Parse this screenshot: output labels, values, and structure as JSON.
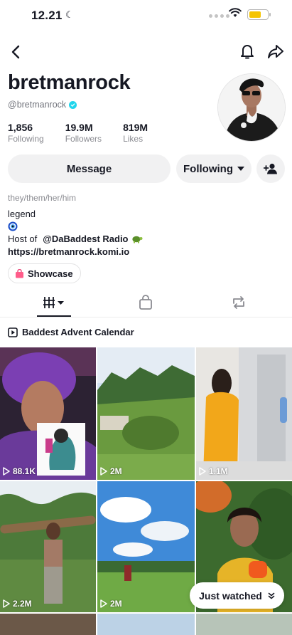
{
  "status_bar": {
    "time": "12.21"
  },
  "profile": {
    "name": "bretmanrock",
    "handle": "@bretmanrock",
    "stats": [
      {
        "value": "1,856",
        "label": "Following"
      },
      {
        "value": "19.9M",
        "label": "Followers"
      },
      {
        "value": "819M",
        "label": "Likes"
      }
    ]
  },
  "actions": {
    "message": "Message",
    "following": "Following"
  },
  "bio": {
    "pronouns": "they/them/her/him",
    "line1": "legend",
    "host_prefix": "Host of",
    "host_mention": "@DaBaddest Radio",
    "link": "https://bretmanrock.komi.io"
  },
  "showcase_label": "Showcase",
  "tabs": [
    "videos",
    "shop",
    "reposts"
  ],
  "playlist_title": "Baddest Advent Calendar",
  "videos": [
    {
      "views": "88.1K"
    },
    {
      "views": "2M"
    },
    {
      "views": "1.1M"
    },
    {
      "views": "2.2M"
    },
    {
      "views": "2M"
    },
    {
      "views": ""
    }
  ],
  "just_watched_label": "Just watched",
  "colors": {
    "verified": "#20d5ec",
    "text": "#161823",
    "muted": "#8a8b91",
    "button_bg": "#f1f1f2",
    "battery": "#f5c400"
  }
}
